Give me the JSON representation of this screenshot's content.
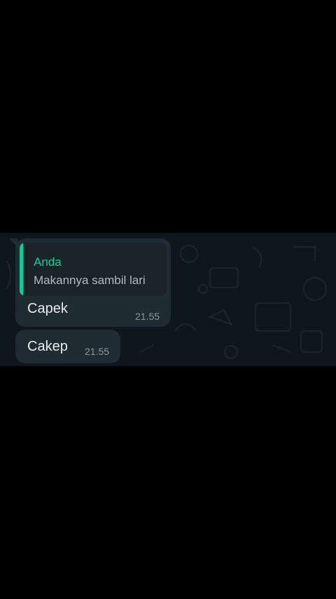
{
  "chat": {
    "messages": [
      {
        "quote": {
          "author": "Anda",
          "text": "Makannya sambil lari"
        },
        "text": "Capek",
        "time": "21.55"
      },
      {
        "text": "Cakep",
        "time": "21.55"
      }
    ]
  },
  "colors": {
    "background": "#000000",
    "wallpaper": "#0e171c",
    "bubble_incoming": "#202c33",
    "quote_accent": "#06cf9c",
    "text_primary": "#e9edef",
    "text_secondary": "#8696a0"
  }
}
